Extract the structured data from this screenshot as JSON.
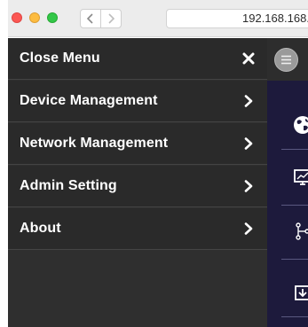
{
  "browser": {
    "url": "192.168.168."
  },
  "menu": {
    "items": [
      {
        "label": "Close Menu",
        "icon": "close-icon"
      },
      {
        "label": "Device Management",
        "icon": "chevron-right-icon"
      },
      {
        "label": "Network Management",
        "icon": "chevron-right-icon"
      },
      {
        "label": "Admin Setting",
        "icon": "chevron-right-icon"
      },
      {
        "label": "About",
        "icon": "chevron-right-icon"
      }
    ]
  },
  "sidenav": {
    "icons": [
      "globe-icon",
      "monitor-icon",
      "network-icon",
      "download-icon"
    ]
  },
  "colors": {
    "menu_background": "#2a2a2a",
    "menu_text": "#ffffff",
    "sidenav_background": "#1d1a3c"
  }
}
